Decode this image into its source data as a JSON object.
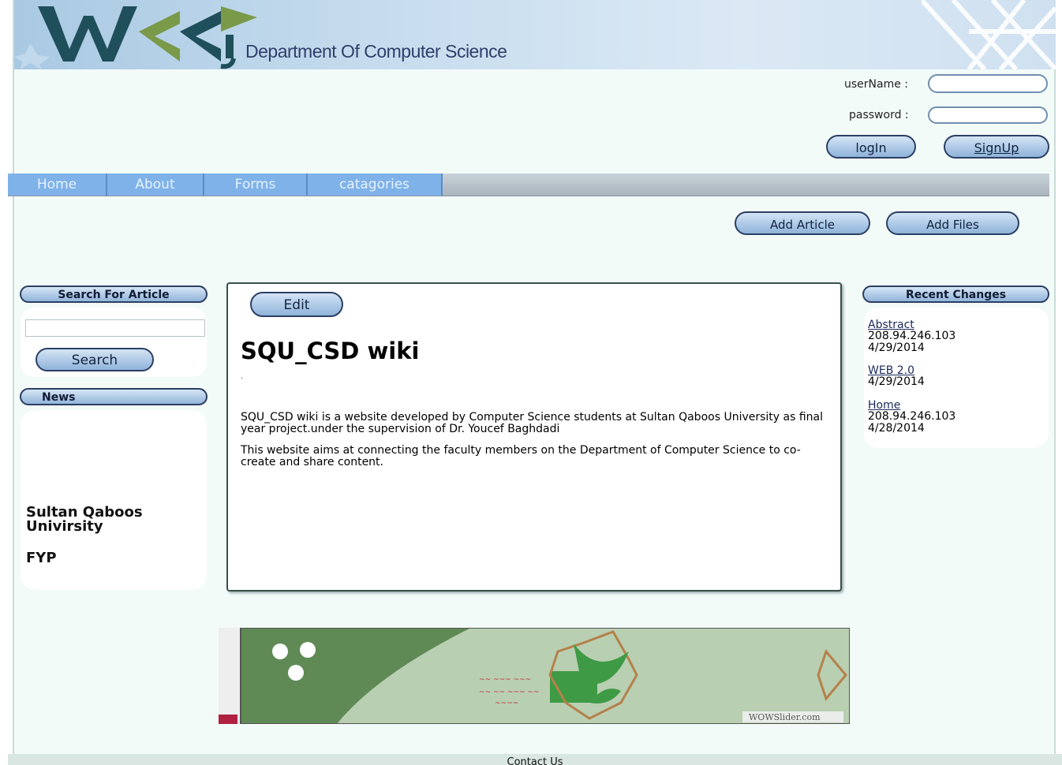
{
  "header": {
    "logo_text": "WiKi",
    "department": "Department Of Computer Science"
  },
  "login": {
    "username_label": "userName :",
    "password_label": "password :",
    "login_button": "logIn",
    "signup_button": "SignUp"
  },
  "nav": {
    "items": [
      {
        "label": "Home"
      },
      {
        "label": "About"
      },
      {
        "label": "Forms"
      },
      {
        "label": "catagories"
      }
    ]
  },
  "actions": {
    "add_article": "Add Article",
    "add_files": "Add Files"
  },
  "sidebar": {
    "search_title": "Search For Article",
    "search_button": "Search",
    "news_title": "News",
    "news_line1": "Sultan Qaboos Univirsity",
    "news_line2": "FYP"
  },
  "main": {
    "edit_button": "Edit",
    "title": "SQU_CSD wiki",
    "dot": ".",
    "para1": "SQU_CSD wiki is a website developed by Computer Science students at Sultan Qaboos University as final year project.under the supervision of Dr. Youcef Baghdadi",
    "para2": "This website aims at connecting the faculty members on the Department of Computer Science to co-create and share content."
  },
  "recent": {
    "title": "Recent Changes",
    "items": [
      {
        "link": "Abstract",
        "ip": "208.94.246.103",
        "date": "4/29/2014"
      },
      {
        "link": "WEB 2.0",
        "date": "4/29/2014"
      },
      {
        "link": "Home",
        "ip": "208.94.246.103",
        "date": "4/28/2014"
      }
    ]
  },
  "slider": {
    "watermark": "WOWSlider.com"
  },
  "footer": {
    "contact": "Contact Us"
  },
  "colors": {
    "nav_blue": "#7fb2e8",
    "button_gradient_top": "#d4e4f5",
    "button_gradient_bottom": "#8fb3da",
    "logo_teal": "#1f4f5a",
    "logo_green": "#7a9a4a"
  }
}
